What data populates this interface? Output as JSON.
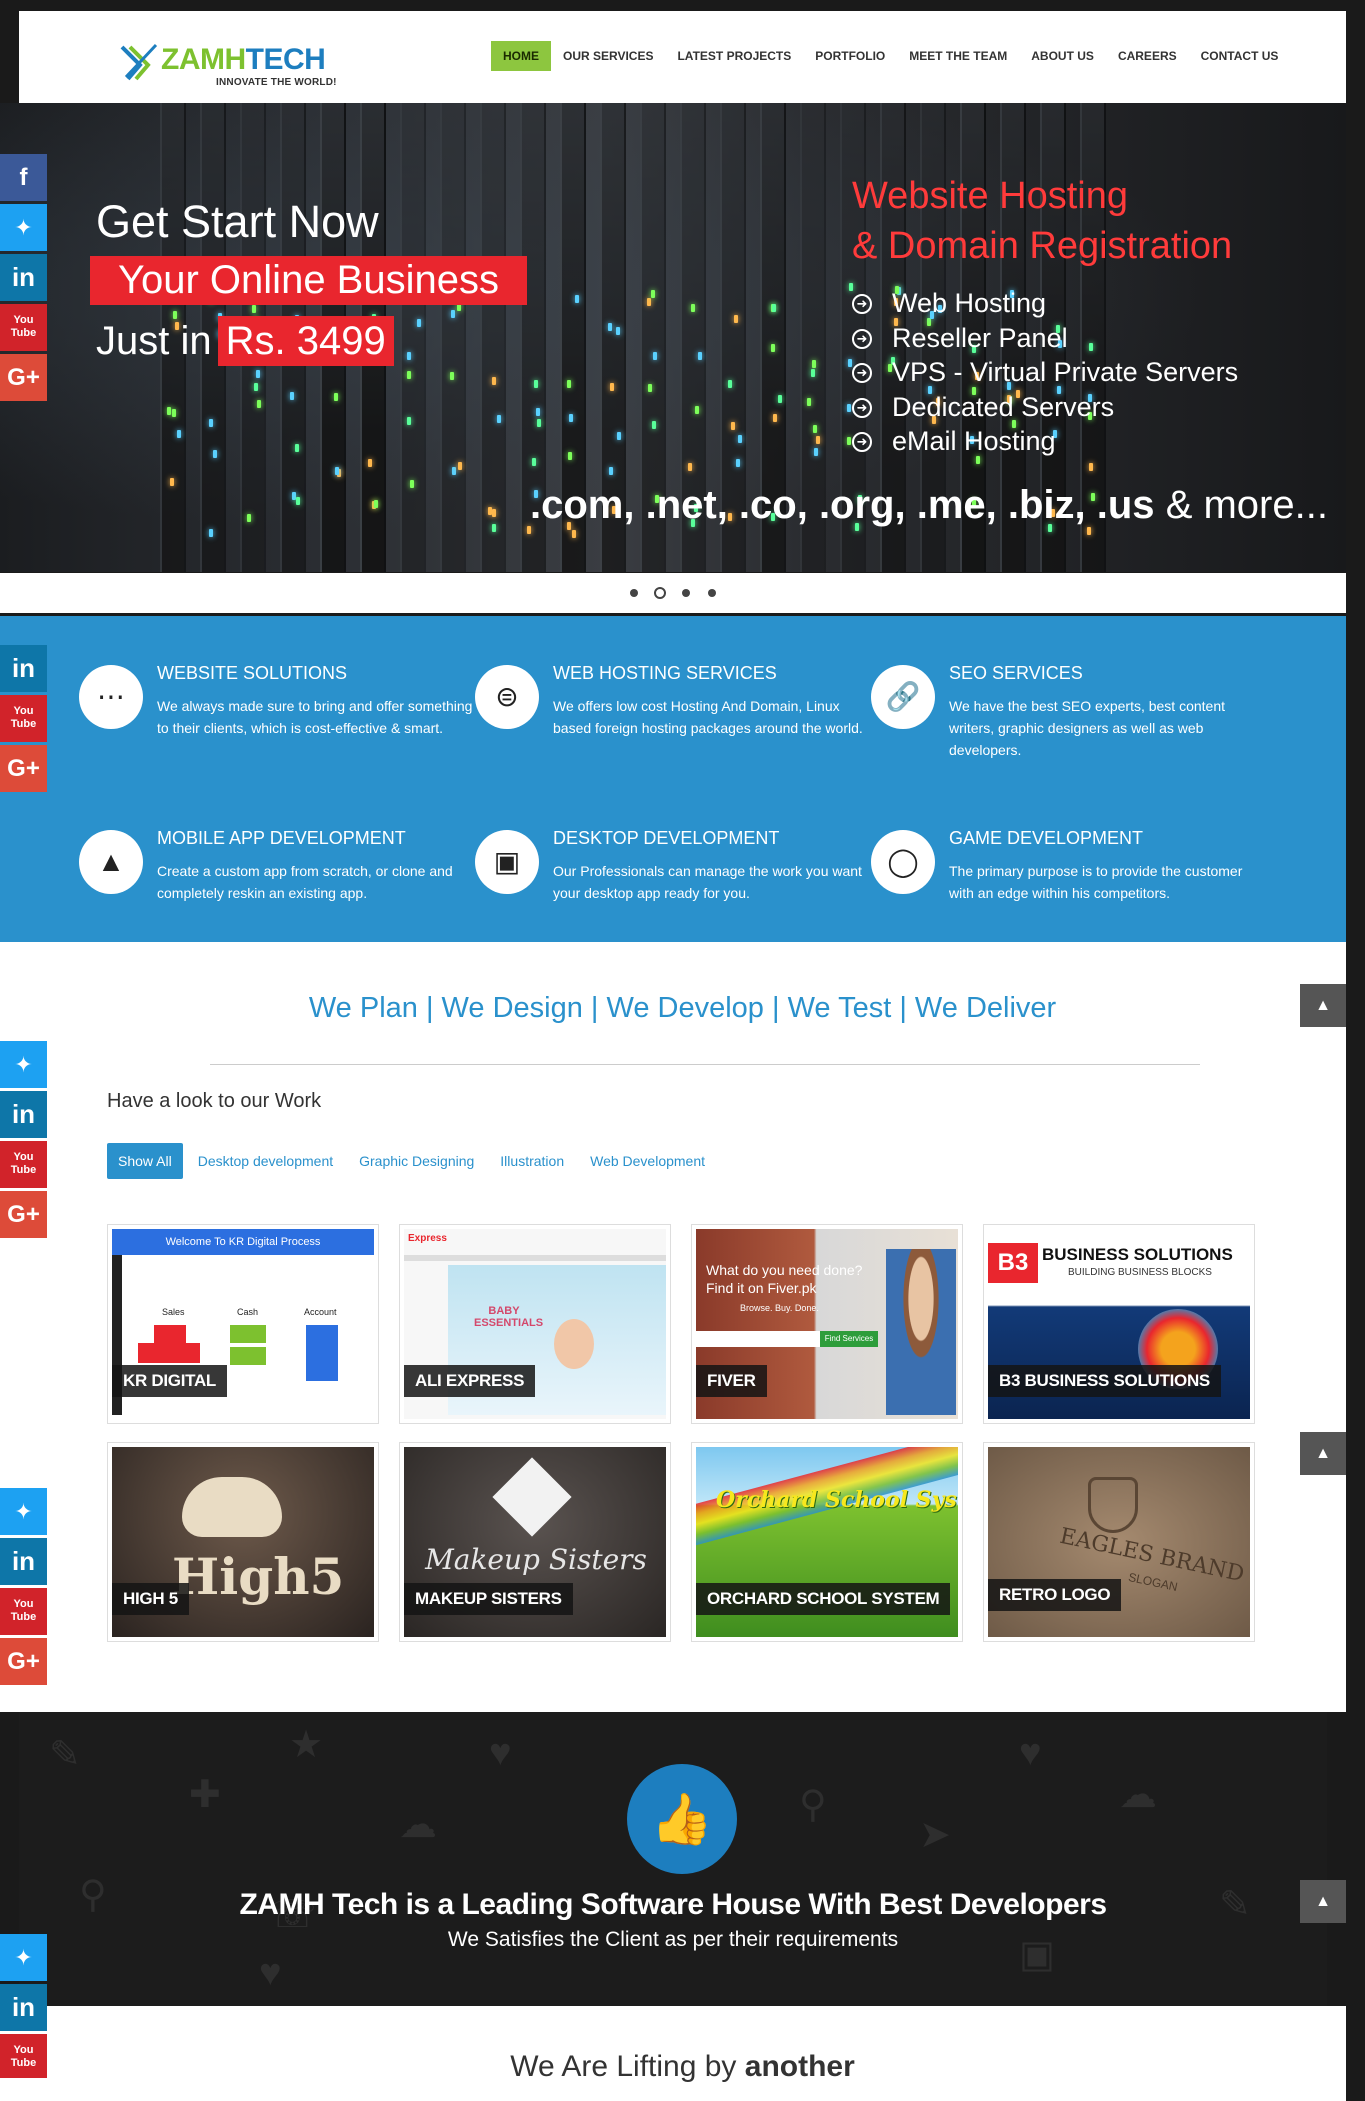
{
  "header": {
    "logo": {
      "word_a": "ZAMH",
      "word_b": "TECH",
      "tagline": "INNOVATE THE WORLD!"
    },
    "nav": [
      "HOME",
      "OUR SERVICES",
      "LATEST PROJECTS",
      "PORTFOLIO",
      "MEET THE TEAM",
      "ABOUT US",
      "CAREERS",
      "CONTACT US"
    ],
    "active_nav": "HOME"
  },
  "hero": {
    "line1": "Get Start Now",
    "line2": "Your Online Business",
    "line3_prefix": "Just in",
    "line3_price": "Rs. 3499",
    "right_title_1": "Website Hosting",
    "right_title_2": "& Domain Registration",
    "list": [
      "Web Hosting",
      "Reseller Panel",
      "VPS - Virtual Private Servers",
      "Dedicated Servers",
      "eMail Hosting"
    ],
    "tlds": ".com, .net, .co, .org, .me, .biz, .us",
    "tlds_more": "& more...",
    "slide_count": 4,
    "active_slide": 2
  },
  "services": [
    {
      "title": "WEBSITE SOLUTIONS",
      "icon": "spinner-dots-icon",
      "desc": "We always made sure to bring and offer something to their clients, which is cost-effective & smart."
    },
    {
      "title": "WEB HOSTING SERVICES",
      "icon": "hosting-disc-icon",
      "desc": "We offers low cost Hosting And Domain, Linux based foreign hosting packages around the world."
    },
    {
      "title": "SEO SERVICES",
      "icon": "link-icon",
      "desc": "We have the best SEO experts, best content writers, graphic designers as well as web developers."
    },
    {
      "title": "MOBILE APP DEVELOPMENT",
      "icon": "android-icon",
      "desc": "Create a custom app from scratch, or clone and completely reskin an existing app."
    },
    {
      "title": "DESKTOP DEVELOPMENT",
      "icon": "monitor-icon",
      "desc": "Our Professionals can manage the work you want your desktop app ready for you."
    },
    {
      "title": "GAME DEVELOPMENT",
      "icon": "gamepad-icon",
      "desc": "The primary purpose is to provide the customer with an edge within his competitors."
    }
  ],
  "main": {
    "tagline": "We Plan | We Design | We Develop | We Test | We Deliver",
    "work_title": "Have a look to our Work",
    "filters": [
      "Show All",
      "Desktop development",
      "Graphic Designing",
      "Illustration",
      "Web Development"
    ],
    "active_filter": "Show All",
    "projects": [
      {
        "caption": "KR DIGITAL",
        "thumb_text": "Welcome To KR Digital Process",
        "labels": [
          "Sales",
          "Cash",
          "Account"
        ]
      },
      {
        "caption": "ALI EXPRESS",
        "thumb_text": "BABY ESSENTIALS",
        "brand": "Express"
      },
      {
        "caption": "FIVER",
        "thumb_text": "What do you need done? Find it on Fiver.pk",
        "sub": "Browse. Buy. Done.",
        "button": "Find Services"
      },
      {
        "caption": "B3 BUSINESS SOLUTIONS",
        "thumb_text": "BUSINESS SOLUTIONS",
        "sub": "BUILDING BUSINESS BLOCKS"
      },
      {
        "caption": "HIGH 5",
        "thumb_text": "High5"
      },
      {
        "caption": "MAKEUP SISTERS",
        "thumb_text": "Makeup Sisters"
      },
      {
        "caption": "ORCHARD SCHOOL SYSTEM",
        "thumb_text": "Orchard School System"
      },
      {
        "caption": "RETRO LOGO",
        "thumb_text": "EAGLES BRAND",
        "sub": "SLOGAN"
      }
    ]
  },
  "banner": {
    "heading": "ZAMH Tech is a Leading Software House With Best Developers",
    "sub": "We Satisfies the Client as per their requirements"
  },
  "bottom": {
    "prefix": "We Are Lifting by",
    "bold": "another"
  },
  "social": [
    "f",
    "t",
    "in",
    "You Tube",
    "G+"
  ],
  "colors": {
    "green": "#8dc63f",
    "blue": "#2a91cc",
    "red": "#e9262e"
  }
}
